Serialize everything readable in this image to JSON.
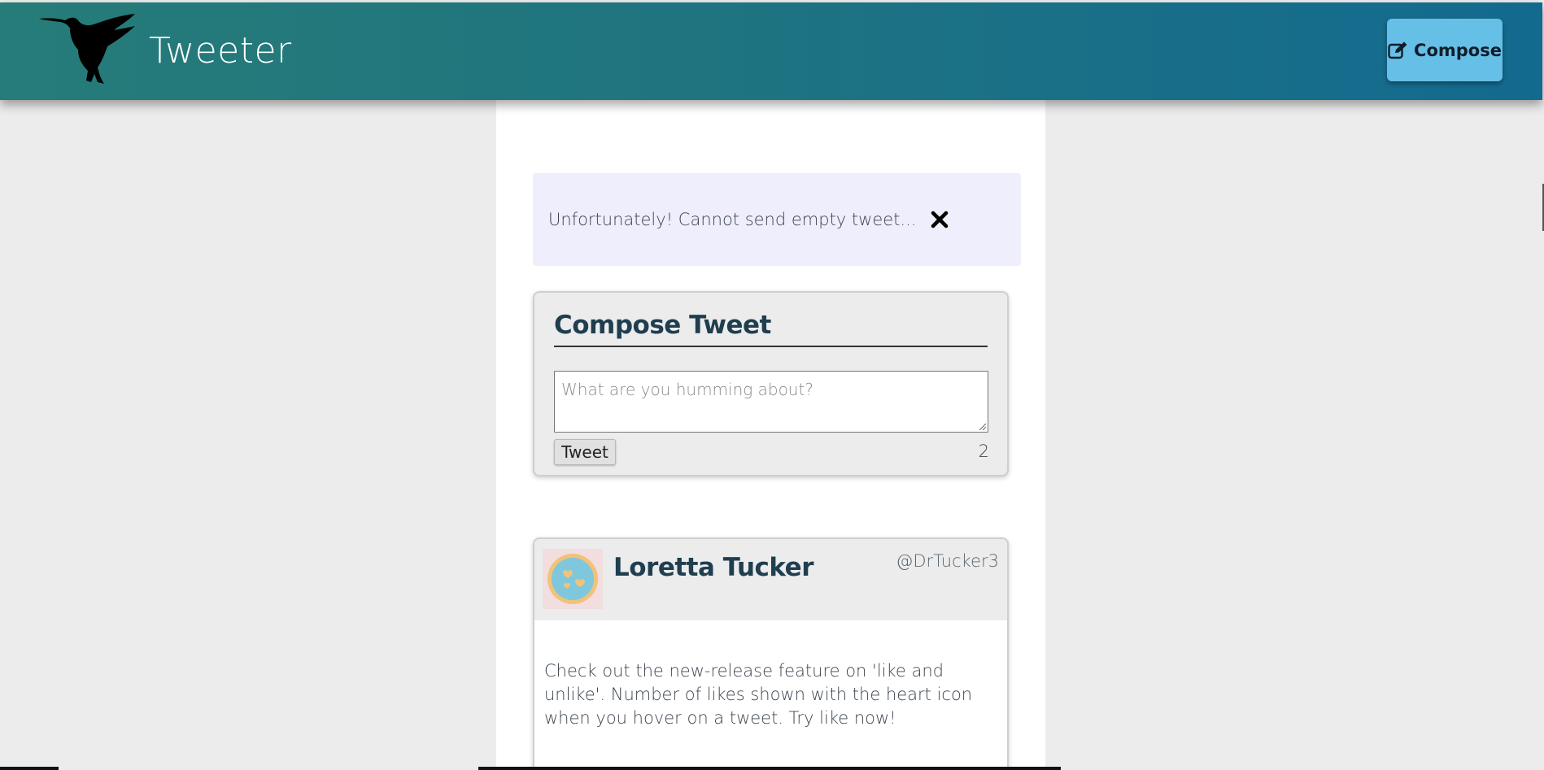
{
  "header": {
    "logo_icon": "hummingbird-icon",
    "brand": "Tweeter",
    "compose_icon": "edit-icon",
    "compose_label": "Compose",
    "accent_colors": [
      "#267c78",
      "#136a8f"
    ],
    "compose_button_color": "#66bfe6"
  },
  "alert": {
    "message": "Unfortunately! Cannot send empty tweet...",
    "close_icon": "close-icon",
    "background": "#eeeefc"
  },
  "compose": {
    "title": "Compose Tweet",
    "placeholder": "What are you humming about?",
    "value": "",
    "tweet_label": "Tweet",
    "char_count": "2"
  },
  "tweets": [
    {
      "avatar_icon": "avatar-icon",
      "name": "Loretta Tucker",
      "handle": "@DrTucker3",
      "text": "Check out the new-release feature on 'like and unlike'. Number of likes shown with the heart icon when you hover on a tweet. Try like now!"
    }
  ]
}
